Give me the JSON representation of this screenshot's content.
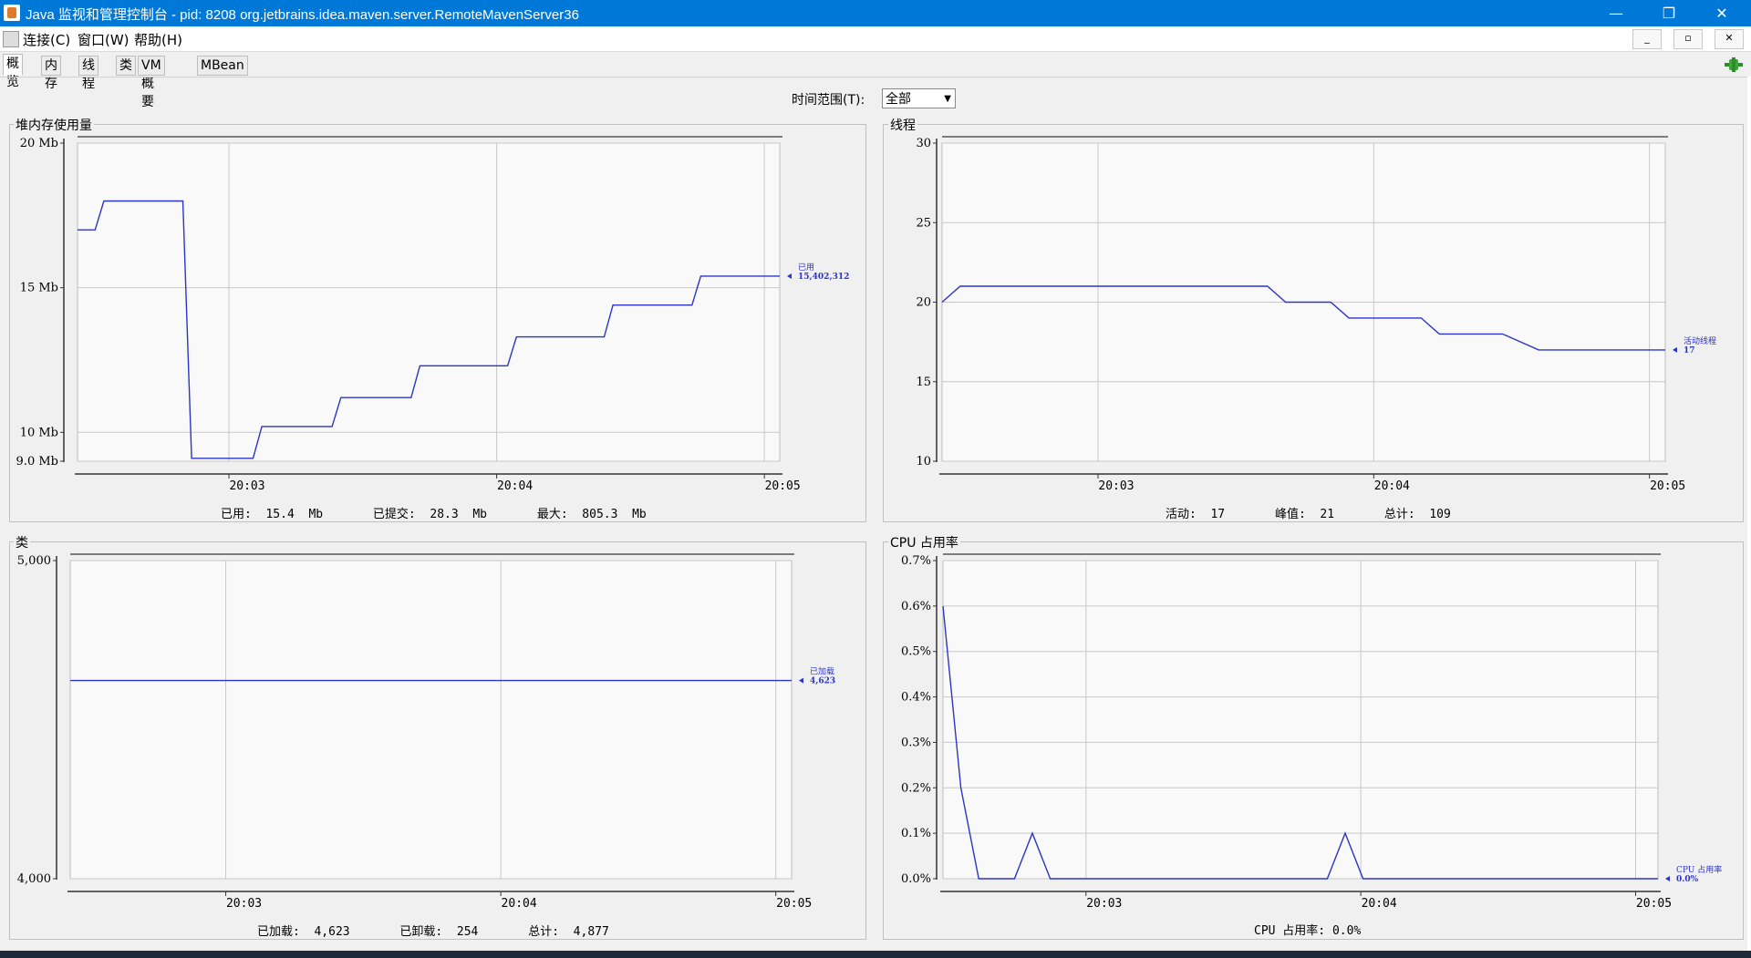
{
  "window": {
    "title": "Java 监视和管理控制台 - pid: 8208 org.jetbrains.idea.maven.server.RemoteMavenServer36",
    "minimize": "—",
    "restore": "❐",
    "close": "✕"
  },
  "menu": {
    "items": [
      "连接(C)",
      "窗口(W)",
      "帮助(H)"
    ],
    "inner_min": "_",
    "inner_restore": "▫",
    "inner_close": "✕"
  },
  "tabs": [
    "概览",
    "内存",
    "线程",
    "类",
    "VM 概要",
    "MBean"
  ],
  "active_tab": "概览",
  "time_range": {
    "label": "时间范围(T):",
    "value": "全部"
  },
  "icons": {
    "connection": "connection-plug-icon"
  },
  "colors": {
    "line": "#2c35c8",
    "accent": "#0078d7",
    "plot_bg": "#f9f9f9"
  },
  "heap": {
    "title": "堆内存使用量",
    "marker_label": "已用",
    "marker_value": "15,402,312",
    "stats": {
      "used_label": "已用:",
      "used": "15.4  Mb",
      "committed_label": "已提交:",
      "committed": "28.3  Mb",
      "max_label": "最大:",
      "max": "805.3  Mb"
    }
  },
  "threads": {
    "title": "线程",
    "marker_label": "活动线程",
    "marker_value": "17",
    "stats": {
      "live_label": "活动:",
      "live": "17",
      "peak_label": "峰值:",
      "peak": "21",
      "total_label": "总计:",
      "total": "109"
    }
  },
  "classes": {
    "title": "类",
    "marker_label": "已加载",
    "marker_value": "4,623",
    "stats": {
      "loaded_label": "已加载:",
      "loaded": "4,623",
      "unloaded_label": "已卸载:",
      "unloaded": "254",
      "total_label": "总计:",
      "total": "4,877"
    }
  },
  "cpu": {
    "title": "CPU 占用率",
    "marker_label": "CPU 占用率",
    "marker_value": "0.0%",
    "stats": {
      "label": "CPU 占用率:",
      "value": "0.0%"
    }
  },
  "chart_data": [
    {
      "type": "line",
      "title": "堆内存使用量",
      "x_ticks": [
        "20:03",
        "20:04",
        "20:05"
      ],
      "x": [
        0,
        0.4,
        0.6,
        1.2,
        2.0,
        2.4,
        2.6,
        3.2,
        3.4,
        4.0,
        4.2,
        5.0,
        5.2,
        5.8,
        6.0,
        6.8,
        7.0,
        7.6,
        7.8,
        8.6,
        8.8,
        9.8,
        10.0,
        10.8,
        11.0,
        12.0,
        12.2,
        12.8,
        13.0,
        14.0,
        14.2,
        15.2,
        15.4,
        16.0
      ],
      "x_tick_positions": [
        3.45,
        9.55,
        15.65
      ],
      "values": [
        17.0,
        17.0,
        18.0,
        18.0,
        18.0,
        18.0,
        9.1,
        9.1,
        9.1,
        9.1,
        10.2,
        10.2,
        10.2,
        10.2,
        11.2,
        11.2,
        11.2,
        11.2,
        12.3,
        12.3,
        12.3,
        12.3,
        13.3,
        13.3,
        13.3,
        13.3,
        14.4,
        14.4,
        14.4,
        14.4,
        15.4,
        15.4,
        15.4,
        15.4
      ],
      "y_ticks": [
        "20 Mb",
        "15 Mb",
        "10 Mb",
        "9.0 Mb"
      ],
      "y_tick_values": [
        20,
        15,
        10,
        9
      ],
      "ylim": [
        9,
        20
      ],
      "series": [
        {
          "name": "已用",
          "values_ref": "values"
        }
      ]
    },
    {
      "type": "line",
      "title": "线程",
      "x_ticks": [
        "20:03",
        "20:04",
        "20:05"
      ],
      "x": [
        0,
        0.4,
        1.0,
        7.2,
        7.6,
        8.6,
        9.0,
        10.0,
        10.6,
        11.0,
        12.0,
        12.4,
        13.2,
        16.0
      ],
      "x_tick_positions": [
        3.45,
        9.55,
        15.65
      ],
      "values": [
        20,
        21,
        21,
        21,
        20,
        20,
        19,
        19,
        19,
        18,
        18,
        18,
        17,
        17
      ],
      "y_ticks": [
        "30",
        "25",
        "20",
        "15",
        "10"
      ],
      "y_tick_values": [
        30,
        25,
        20,
        15,
        10
      ],
      "ylim": [
        10,
        30
      ],
      "series": [
        {
          "name": "活动线程",
          "values_ref": "values"
        }
      ]
    },
    {
      "type": "line",
      "title": "类",
      "x_ticks": [
        "20:03",
        "20:04",
        "20:05"
      ],
      "x": [
        0,
        16.0
      ],
      "x_tick_positions": [
        3.45,
        9.55,
        15.65
      ],
      "values": [
        4623,
        4623
      ],
      "y_ticks": [
        "5,000",
        "4,000"
      ],
      "y_tick_values": [
        5000,
        4000
      ],
      "ylim": [
        4000,
        5000
      ],
      "series": [
        {
          "name": "已加载",
          "values_ref": "values"
        }
      ]
    },
    {
      "type": "line",
      "title": "CPU 占用率",
      "x_ticks": [
        "20:03",
        "20:04",
        "20:05"
      ],
      "x": [
        0,
        0.4,
        0.8,
        1.6,
        2.0,
        2.4,
        8.6,
        9.0,
        9.4,
        16.0
      ],
      "x_tick_positions": [
        3.2,
        9.35,
        15.5
      ],
      "values": [
        0.6,
        0.2,
        0.0,
        0.0,
        0.1,
        0.0,
        0.0,
        0.1,
        0.0,
        0.0
      ],
      "y_ticks": [
        "0.7%",
        "0.6%",
        "0.5%",
        "0.4%",
        "0.3%",
        "0.2%",
        "0.1%",
        "0.0%"
      ],
      "y_tick_values": [
        0.7,
        0.6,
        0.5,
        0.4,
        0.3,
        0.2,
        0.1,
        0.0
      ],
      "ylim": [
        0,
        0.7
      ],
      "series": [
        {
          "name": "CPU 占用率",
          "values_ref": "values"
        }
      ]
    }
  ]
}
